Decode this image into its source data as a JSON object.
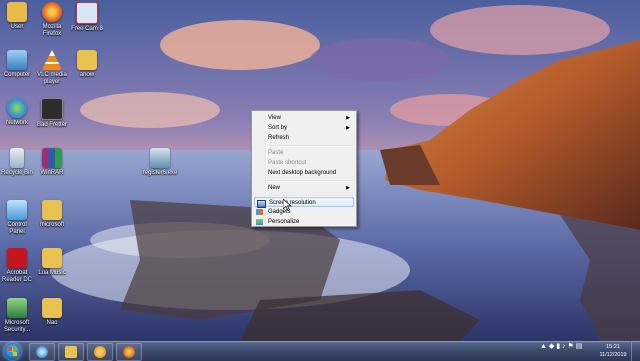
{
  "desktop": {
    "icons": [
      {
        "label": "User",
        "icon": "user-folder-icon",
        "color": "#e9b94a"
      },
      {
        "label": "Mozilla Firefox",
        "icon": "firefox-icon",
        "color": "#e66a21"
      },
      {
        "label": "Free Cam 8",
        "icon": "freecam-icon",
        "color": "#d9e6f5"
      },
      {
        "label": "Computer",
        "icon": "computer-icon",
        "color": "#6fa6d8"
      },
      {
        "label": "VLC media player",
        "icon": "vlc-icon",
        "color": "#f08a12"
      },
      {
        "label": "anow",
        "icon": "folder-icon",
        "color": "#e9c150"
      },
      {
        "label": "Network",
        "icon": "network-icon",
        "color": "#3a8fd0"
      },
      {
        "label": "Bad Fretter",
        "icon": "app-icon",
        "color": "#2c2c2c"
      },
      {
        "label": "Recycle Bin",
        "icon": "recycle-bin-icon",
        "color": "#b9c7d6"
      },
      {
        "label": "WinRAR",
        "icon": "winrar-icon",
        "color": "#9a2f7a"
      },
      {
        "label": "register6.exe",
        "icon": "installer-icon",
        "color": "#5f8fb0"
      },
      {
        "label": "Control Panel",
        "icon": "control-panel-icon",
        "color": "#4a9ad8"
      },
      {
        "label": "microsoft",
        "icon": "folder-icon",
        "color": "#e9c150"
      },
      {
        "label": "Acrobat Reader DC",
        "icon": "acrobat-icon",
        "color": "#c4161c"
      },
      {
        "label": "Lua Music",
        "icon": "folder-icon",
        "color": "#e9c150"
      },
      {
        "label": "Microsoft Security...",
        "icon": "security-icon",
        "color": "#2f7d3a"
      },
      {
        "label": "Nao",
        "icon": "folder-icon",
        "color": "#e9c150"
      }
    ]
  },
  "context_menu": {
    "items": [
      {
        "label": "View",
        "submenu": true
      },
      {
        "label": "Sort by",
        "submenu": true
      },
      {
        "label": "Refresh"
      },
      {
        "label": "Paste",
        "disabled": true
      },
      {
        "label": "Paste shortcut",
        "disabled": true
      },
      {
        "label": "Next desktop background"
      },
      {
        "label": "New",
        "submenu": true
      },
      {
        "label": "Screen resolution",
        "icon": "screen-resolution-icon",
        "hover": true
      },
      {
        "label": "Gadgets",
        "icon": "gadgets-icon"
      },
      {
        "label": "Personalize",
        "icon": "personalize-icon"
      }
    ],
    "arrow_glyph": "▶"
  },
  "taskbar": {
    "pinned": [
      {
        "name": "internet-explorer",
        "icon": "internet-explorer-icon",
        "color": "#3b8fe0"
      },
      {
        "name": "windows-explorer",
        "icon": "folder-icon",
        "color": "#e9c150"
      },
      {
        "name": "media-player",
        "icon": "media-player-icon",
        "color": "#f09a20"
      },
      {
        "name": "firefox",
        "icon": "firefox-icon",
        "color": "#e66a21"
      }
    ],
    "clock": {
      "time": "15:21",
      "date": "11/12/2019"
    },
    "tray_glyphs": [
      "▲",
      "◆",
      "▮",
      "♪",
      "⚑",
      "▤"
    ],
    "accent": "#2b3756"
  }
}
